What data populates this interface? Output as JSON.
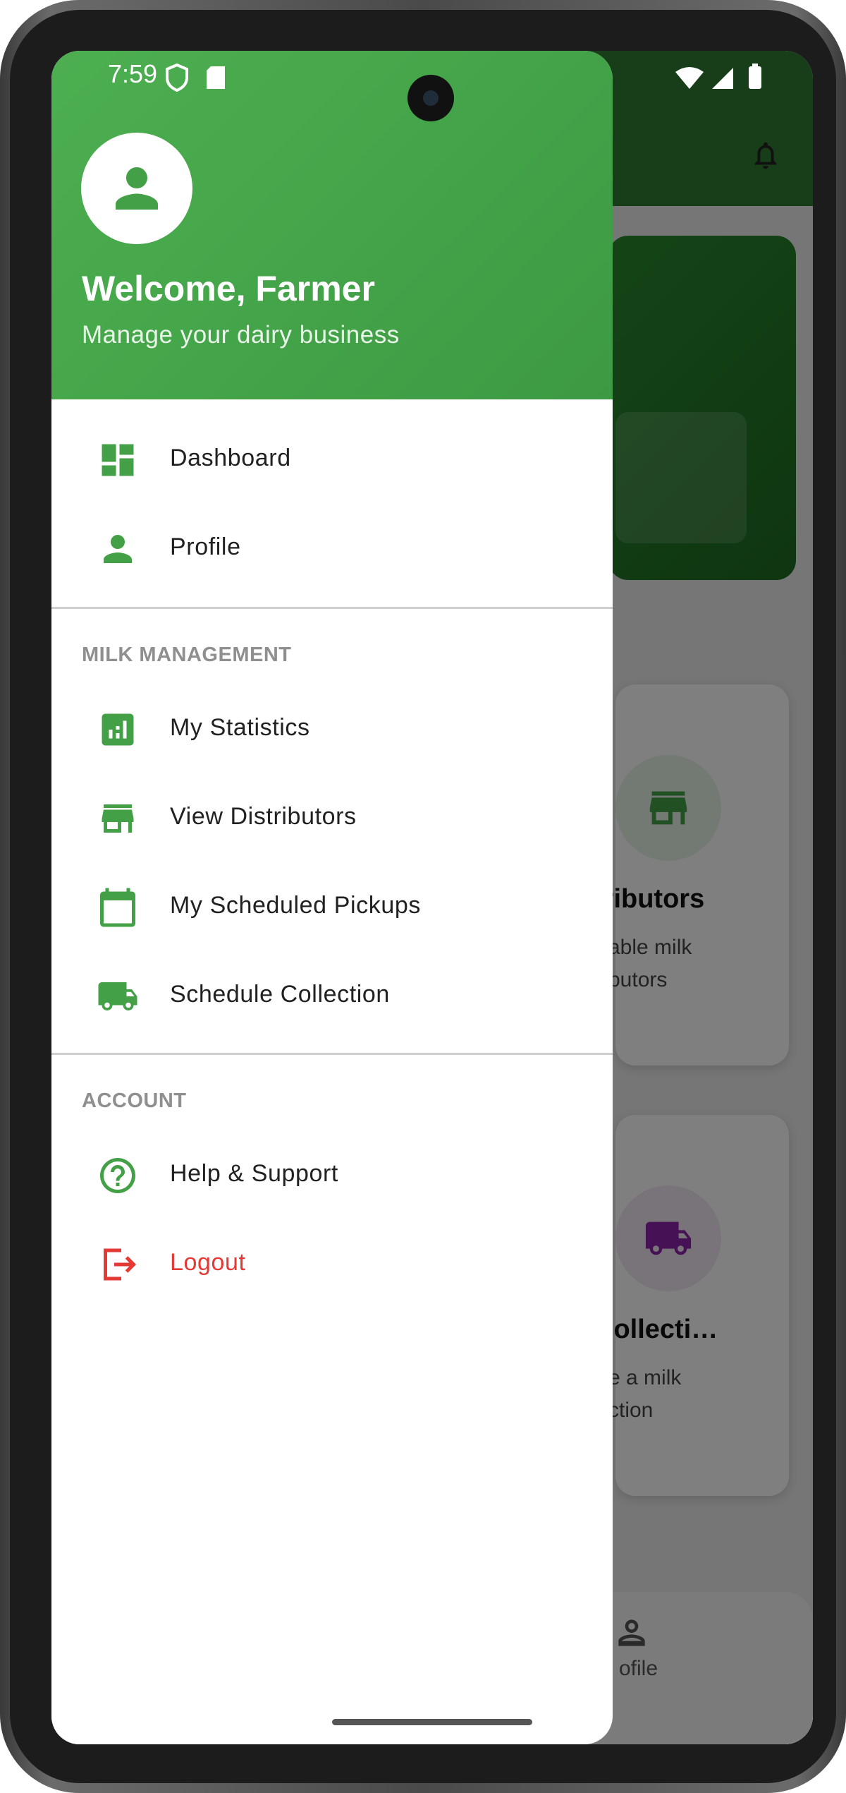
{
  "status_bar": {
    "time": "7:59"
  },
  "drawer": {
    "header": {
      "welcome": "Welcome, Farmer",
      "subtitle": "Manage your dairy business"
    },
    "main_items": [
      {
        "label": "Dashboard",
        "icon": "dashboard-icon"
      },
      {
        "label": "Profile",
        "icon": "person-icon"
      }
    ],
    "milk_section": {
      "title": "MILK MANAGEMENT",
      "items": [
        {
          "label": "My Statistics",
          "icon": "bar-chart-icon"
        },
        {
          "label": "View Distributors",
          "icon": "storefront-icon"
        },
        {
          "label": "My Scheduled Pickups",
          "icon": "calendar-icon"
        },
        {
          "label": "Schedule Collection",
          "icon": "truck-icon"
        }
      ]
    },
    "account_section": {
      "title": "ACCOUNT",
      "items": [
        {
          "label": "Help & Support",
          "icon": "help-icon"
        },
        {
          "label": "Logout",
          "icon": "logout-icon"
        }
      ]
    }
  },
  "background": {
    "cards": [
      {
        "title": "tributors",
        "desc_line1": "able milk",
        "desc_line2": "butors",
        "icon": "storefront-icon"
      },
      {
        "title": "Collecti…",
        "desc_line1": "e a milk",
        "desc_line2": "ction",
        "icon": "truck-icon"
      }
    ],
    "bottom_nav_label": "ofile"
  },
  "colors": {
    "primary_green": "#4caf50",
    "icon_green": "#43a047",
    "logout_red": "#e53935",
    "section_gray": "#8f8f8f"
  }
}
